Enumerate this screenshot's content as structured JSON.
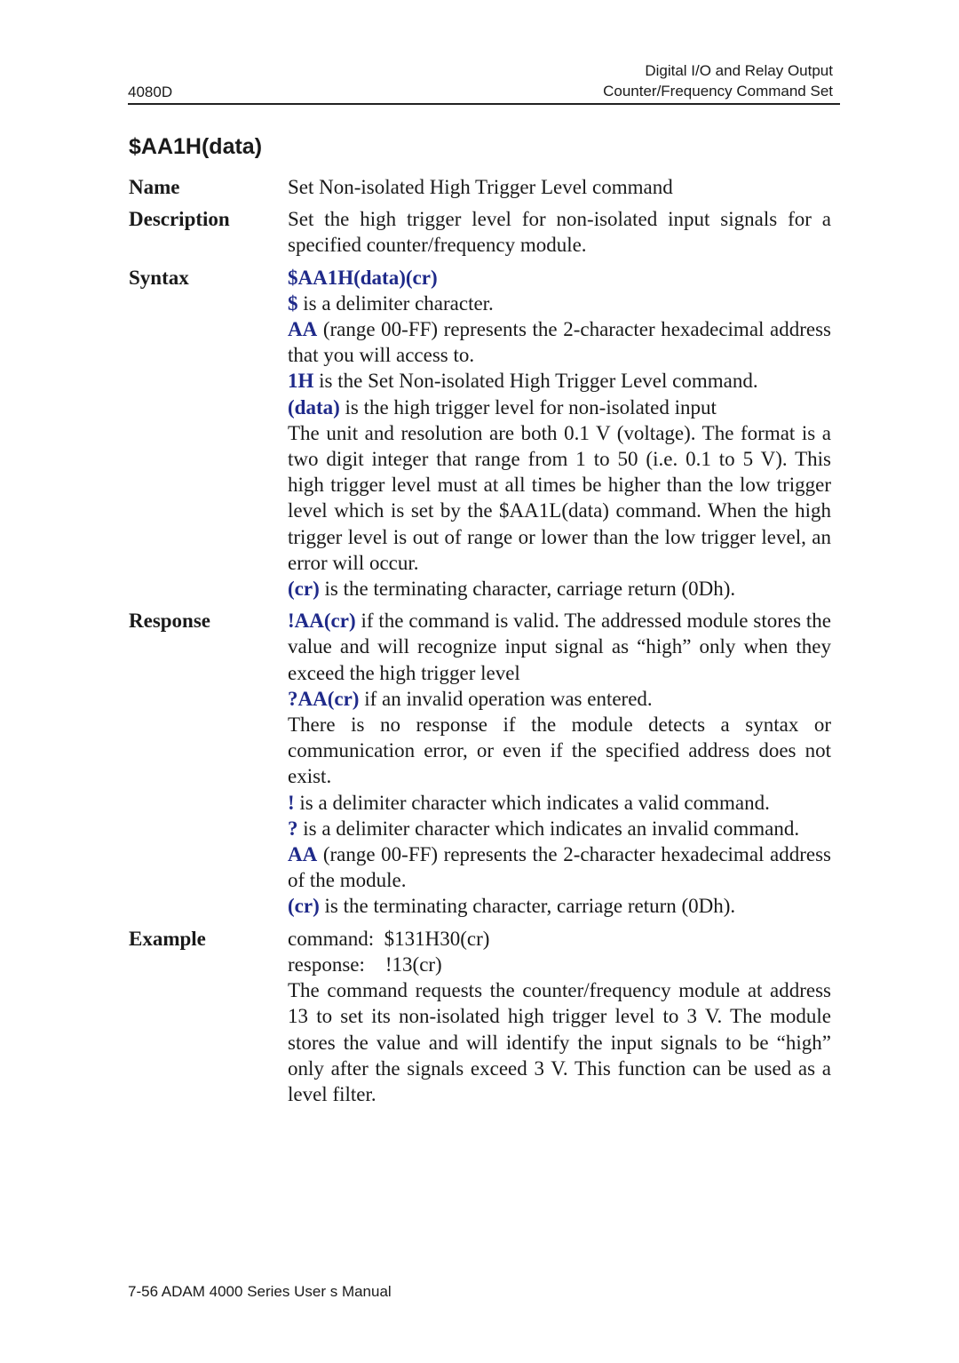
{
  "header": {
    "model": "4080D",
    "section_line1": "Digital I/O and Relay Output",
    "section_line2": "Counter/Frequency Command Set"
  },
  "title": "$AA1H(data)",
  "name": {
    "label": "Name",
    "text": "Set Non-isolated High Trigger Level command"
  },
  "description": {
    "label": "Description",
    "text": "Set the high trigger level for non-isolated input signals for a specified counter/frequency module."
  },
  "syntax": {
    "label": "Syntax",
    "command": "$AA1H(data)(cr)",
    "items": [
      {
        "term": "$",
        "text": " is a delimiter character."
      },
      {
        "term": "AA",
        "text": " (range 00-FF) represents the 2-character hexadecimal address that you will access to."
      },
      {
        "term": "1H",
        "text": " is the Set Non-isolated High Trigger Level command."
      },
      {
        "term": "(data)",
        "text": " is the high trigger level for non-isolated input"
      }
    ],
    "data_detail": "The unit and resolution are both 0.1 V (voltage). The format is a two digit integer that range from 1 to 50 (i.e. 0.1 to 5 V). This high trigger level must at all times be higher than the low trigger level which is set by the $AA1L(data) command. When the high trigger level is out of range or lower than the low trigger level, an error will occur.",
    "cr": {
      "term": "(cr)",
      "text": " is the terminating character, carriage return (0Dh)."
    }
  },
  "response": {
    "label": "Response",
    "valid": {
      "term": "!AA(cr)",
      "text": " if the command is valid. The addressed module stores the value and will recognize input signal as “high” only when they exceed the high trigger level"
    },
    "invalid": {
      "term": "?AA(cr)",
      "text": " if an invalid operation was entered."
    },
    "no_response": "There is no response if the module detects a syntax or communication error, or even if the specified address does not exist.",
    "items": [
      {
        "term": "!",
        "text": " is a delimiter character which indicates a valid command."
      },
      {
        "term": "?",
        "text": " is a delimiter character which indicates an invalid command."
      },
      {
        "term": "AA",
        "text": " (range 00-FF) represents the 2-character hexadecimal address of the module."
      },
      {
        "term": "(cr)",
        "text": " is the terminating character, carriage return (0Dh)."
      }
    ]
  },
  "example": {
    "label": "Example",
    "command_label": "command:",
    "command_value": "$131H30(cr)",
    "response_label": "response:",
    "response_value": "!13(cr)",
    "explanation": "The command requests the counter/frequency module at address 13 to set its non-isolated high trigger level to 3 V. The module stores the value and will identify the input signals to be “high” only after the signals exceed 3 V. This function can be used as a level filter."
  },
  "footer": "7-56 ADAM 4000 Series User s Manual"
}
